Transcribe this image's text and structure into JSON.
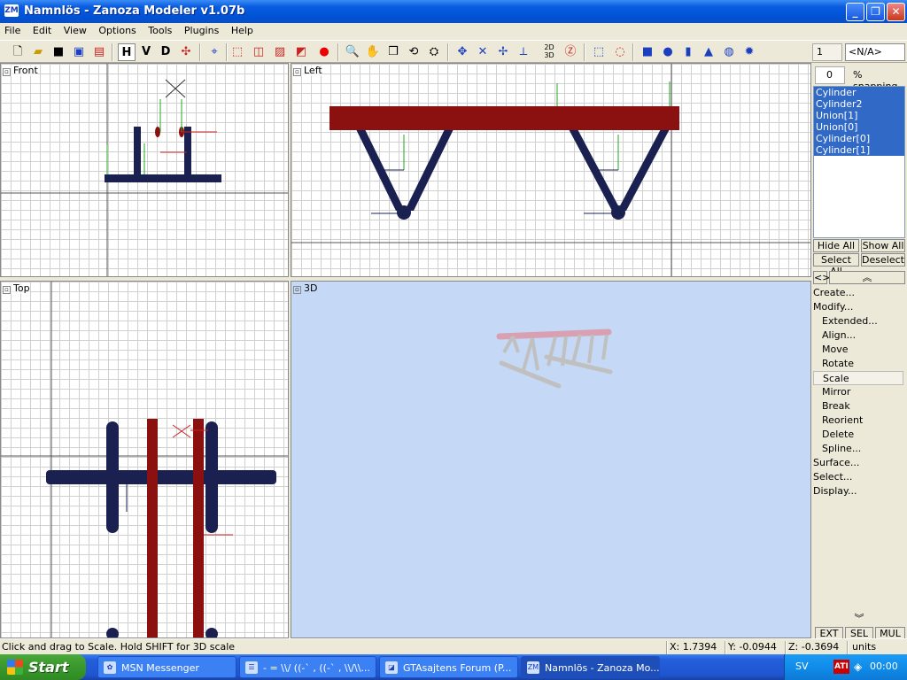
{
  "window": {
    "title": "Namnlös - Zanoza Modeler v1.07b",
    "app_icon": "ZM",
    "controls": {
      "minimize": "_",
      "maximize": "❐",
      "close": "✕"
    }
  },
  "menu": [
    "File",
    "Edit",
    "View",
    "Options",
    "Tools",
    "Plugins",
    "Help"
  ],
  "toolbar": {
    "letters": {
      "h": "H",
      "v": "V",
      "d": "D"
    },
    "icons": [
      "new-file-icon",
      "open-folder-icon",
      "save-icon",
      "save-as-icon",
      "export-icon",
      "view-h",
      "view-v",
      "view-d",
      "axes-icon",
      "vertex-icon",
      "wire-box-icon",
      "box-icon",
      "solid-box-icon",
      "red-box-icon",
      "sphere-icon",
      "zoom-icon",
      "pan-hand-icon",
      "cube-icon",
      "rotate-icon",
      "preview-icon",
      "move-icon",
      "scale-icon",
      "rotate-axis-icon",
      "axis-icon",
      "2d-3d-icon",
      "z-icon",
      "select-rect-icon",
      "select-circle-icon",
      "cube-prim-icon",
      "sphere-prim-icon",
      "cylinder-prim-icon",
      "cone-prim-icon",
      "torus-prim-icon",
      "gear-prim-icon"
    ],
    "layer_value": "1",
    "layer_name": "<N/A>",
    "snap_value": "0",
    "snap_label": "% snapping"
  },
  "viewports": {
    "front": {
      "label": "Front"
    },
    "left": {
      "label": "Left"
    },
    "top": {
      "label": "Top"
    },
    "perspective": {
      "label": "3D"
    }
  },
  "objects": [
    "Cylinder",
    "Cylinder2",
    "Union[1]",
    "Union[0]",
    "Cylinder[0]",
    "Cylinder[1]"
  ],
  "panel_buttons": {
    "hide_all": "Hide All",
    "show_all": "Show All",
    "select_all": "Select All",
    "deselect": "Deselect",
    "nav": "<>"
  },
  "commands": [
    {
      "label": "Create...",
      "indent": false,
      "selected": false
    },
    {
      "label": "Modify...",
      "indent": false,
      "selected": false
    },
    {
      "label": "Extended...",
      "indent": true,
      "selected": false
    },
    {
      "label": "Align...",
      "indent": true,
      "selected": false
    },
    {
      "label": "Move",
      "indent": true,
      "selected": false
    },
    {
      "label": "Rotate",
      "indent": true,
      "selected": false
    },
    {
      "label": "Scale",
      "indent": true,
      "selected": true
    },
    {
      "label": "Mirror",
      "indent": true,
      "selected": false
    },
    {
      "label": "Break",
      "indent": true,
      "selected": false
    },
    {
      "label": "Reorient",
      "indent": true,
      "selected": false
    },
    {
      "label": "Delete",
      "indent": true,
      "selected": false
    },
    {
      "label": "Spline...",
      "indent": true,
      "selected": false
    },
    {
      "label": "Surface...",
      "indent": false,
      "selected": false
    },
    {
      "label": "Select...",
      "indent": false,
      "selected": false
    },
    {
      "label": "Display...",
      "indent": false,
      "selected": false
    }
  ],
  "bottom_tabs": [
    "EXT",
    "SEL",
    "MUL"
  ],
  "status": {
    "hint": "Click and drag to Scale. Hold SHIFT for 3D scale",
    "x": "X: 1.7394",
    "y": "Y: -0.0944",
    "z": "Z: -0.3694",
    "units": "units"
  },
  "taskbar": {
    "start": "Start",
    "items": [
      {
        "label": "MSN Messenger",
        "active": false
      },
      {
        "label": "- = \\\\/ ((-` , ((-` , \\\\/\\\\...",
        "active": false
      },
      {
        "label": "GTAsajtens Forum (P...",
        "active": false
      },
      {
        "label": "Namnlös - Zanoza Mo...",
        "active": true
      }
    ],
    "lang": "SV",
    "clock": "00:00"
  },
  "colors": {
    "navy_part": "#1a2050",
    "red_part": "#8b1010",
    "pink_part": "#d8a0b0",
    "grey_part": "#c0c0c0",
    "selection": "#3169c6"
  }
}
